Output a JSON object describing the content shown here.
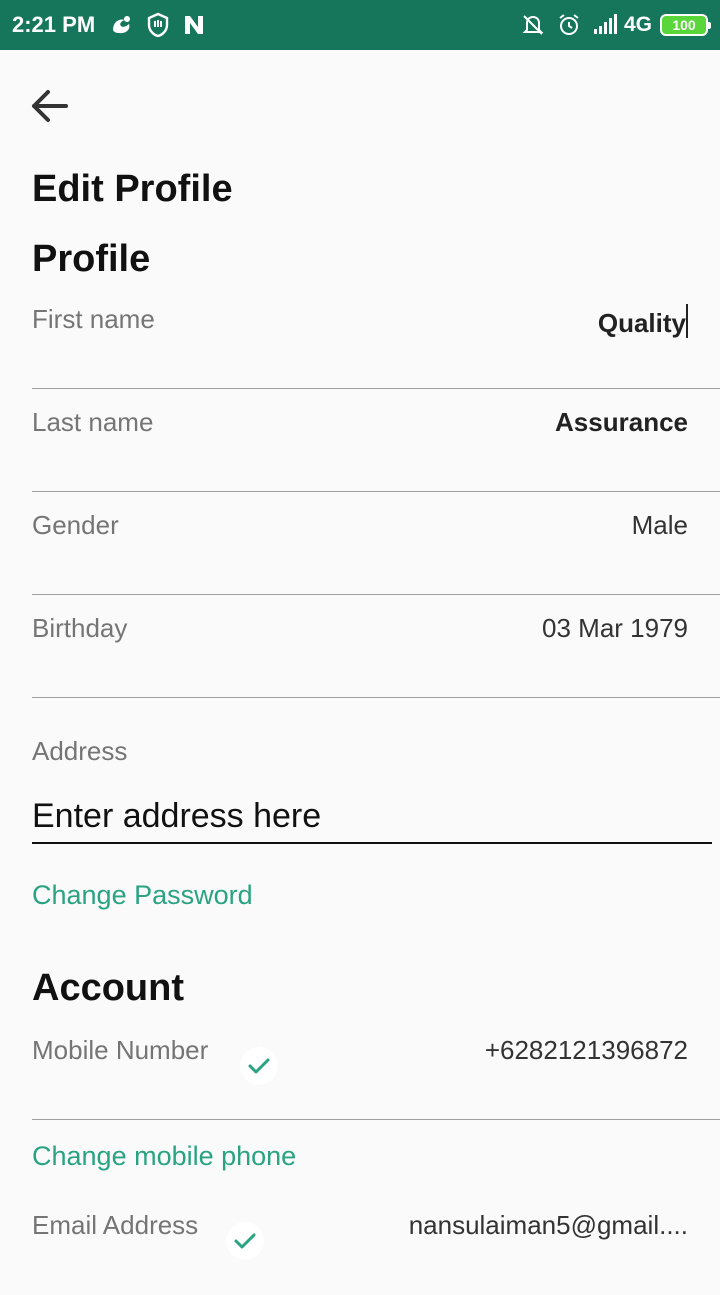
{
  "status_bar": {
    "time": "2:21 PM",
    "network": "4G",
    "battery": "100",
    "background": "#16765c",
    "icons": [
      "uc-browser-icon",
      "hand-shield-icon",
      "n-app-icon",
      "mute-bell-icon",
      "alarm-icon",
      "signal-icon"
    ]
  },
  "header": {
    "back_icon": "arrow-left-icon",
    "title": "Edit Profile"
  },
  "profile": {
    "section_title": "Profile",
    "first_name": {
      "label": "First name",
      "value": "Quality"
    },
    "last_name": {
      "label": "Last name",
      "value": "Assurance"
    },
    "gender": {
      "label": "Gender",
      "value": "Male"
    },
    "birthday": {
      "label": "Birthday",
      "value": "03 Mar 1979"
    },
    "address": {
      "label": "Address",
      "placeholder": "Enter address here"
    },
    "change_password": "Change Password"
  },
  "account": {
    "section_title": "Account",
    "mobile": {
      "label": "Mobile Number",
      "value": "+6282121396872",
      "verified_icon": "check-icon"
    },
    "change_mobile": "Change mobile phone",
    "email": {
      "label": "Email Address",
      "value": "nansulaiman5@gmail....",
      "verified_icon": "check-icon"
    }
  },
  "colors": {
    "accent": "#2aa382",
    "status_bar": "#16765c",
    "label": "#757575"
  }
}
